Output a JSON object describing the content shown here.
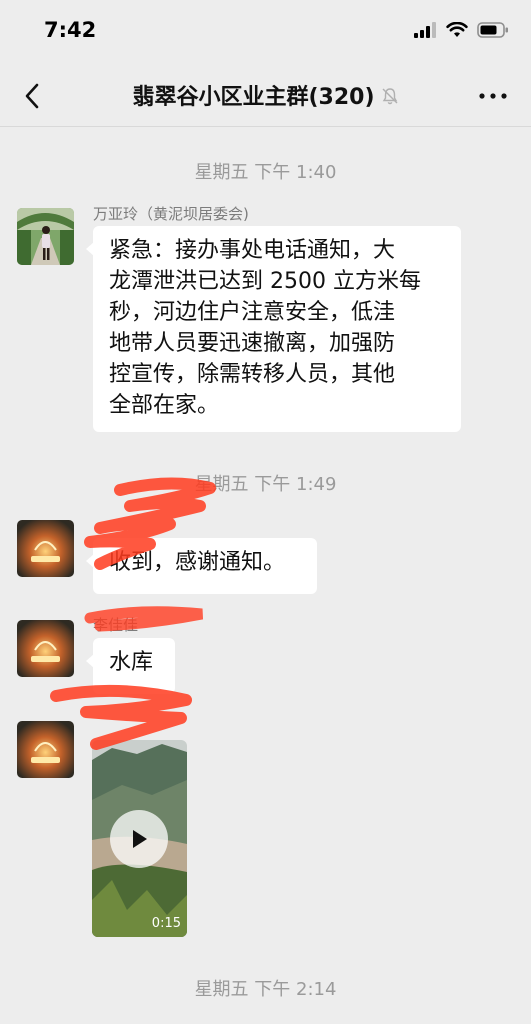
{
  "status_bar": {
    "time": "7:42"
  },
  "nav": {
    "title": "翡翠谷小区业主群(320)",
    "back_icon": "chevron-left-icon",
    "more_icon": "more-dots-icon",
    "mute_icon": "bell-muted-icon"
  },
  "messages": {
    "ts1": "星期五 下午 1:40",
    "m1_sender": "万亚玲（黄泥坝居委会)",
    "m1_lines": [
      "紧急：接办事处电话通知，大",
      "龙潭泄洪已达到 2500 立方米每",
      "秒，河边住户注意安全，低洼",
      "地带人员要迅速撤离，加强防",
      "控宣传，除需转移人员，其他",
      "全部在家。"
    ],
    "ts2": "星期五 下午 1:49",
    "m2_text": "收到，感谢通知。",
    "m3_sender": "李佳佳",
    "m3_text": "水库",
    "m4_video_duration": "0:15",
    "ts3": "星期五 下午 2:14"
  },
  "colors": {
    "background": "#ededed",
    "bubble": "#ffffff",
    "timestamp": "#9a9a9a",
    "redaction": "#ff3b1f"
  }
}
